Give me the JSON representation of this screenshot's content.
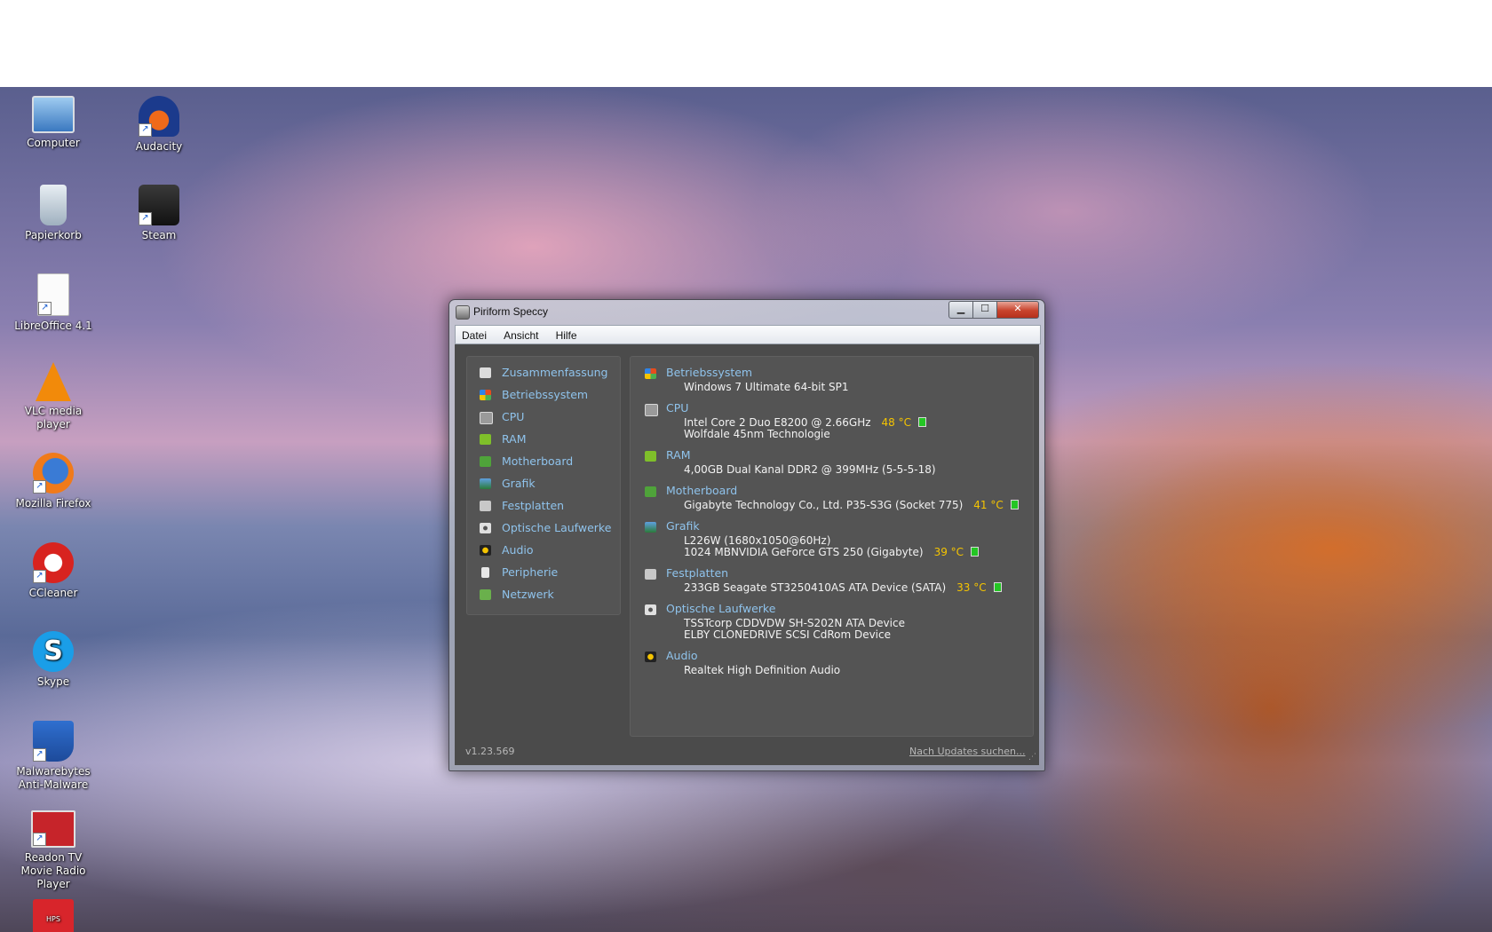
{
  "desktop": {
    "icons": [
      {
        "label": "Computer",
        "icon": "computer-icon"
      },
      {
        "label": "Audacity",
        "icon": "audacity-icon"
      },
      {
        "label": "Papierkorb",
        "icon": "recycle-bin-icon"
      },
      {
        "label": "Steam",
        "icon": "steam-icon"
      },
      {
        "label": "LibreOffice 4.1",
        "icon": "libreoffice-icon"
      },
      {
        "label": "VLC media player",
        "icon": "vlc-icon"
      },
      {
        "label": "Mozilla Firefox",
        "icon": "firefox-icon"
      },
      {
        "label": "CCleaner",
        "icon": "ccleaner-icon"
      },
      {
        "label": "Skype",
        "icon": "skype-icon",
        "glyph": "S"
      },
      {
        "label": "Malwarebytes Anti-Malware",
        "icon": "malwarebytes-icon"
      },
      {
        "label": "Readon TV Movie Radio Player",
        "icon": "readon-tv-icon"
      },
      {
        "label": "",
        "icon": "pdf-icon",
        "glyph": "HPS"
      }
    ]
  },
  "window": {
    "title": "Piriform Speccy",
    "buttons": {
      "minimize": "▁",
      "maximize": "☐",
      "close": "✕"
    },
    "menu": [
      "Datei",
      "Ansicht",
      "Hilfe"
    ],
    "sidebar": [
      {
        "label": "Zusammenfassung",
        "icon": "summary-icon"
      },
      {
        "label": "Betriebssystem",
        "icon": "windows-icon"
      },
      {
        "label": "CPU",
        "icon": "cpu-icon"
      },
      {
        "label": "RAM",
        "icon": "ram-icon"
      },
      {
        "label": "Motherboard",
        "icon": "motherboard-icon"
      },
      {
        "label": "Grafik",
        "icon": "monitor-icon"
      },
      {
        "label": "Festplatten",
        "icon": "hard-disk-icon"
      },
      {
        "label": "Optische Laufwerke",
        "icon": "optical-drive-icon"
      },
      {
        "label": "Audio",
        "icon": "speaker-icon"
      },
      {
        "label": "Peripherie",
        "icon": "mouse-icon"
      },
      {
        "label": "Netzwerk",
        "icon": "network-icon"
      }
    ],
    "summary": {
      "os": {
        "title": "Betriebssystem",
        "lines": [
          "Windows 7 Ultimate 64-bit SP1"
        ]
      },
      "cpu": {
        "title": "CPU",
        "lines": [
          "Intel Core 2 Duo E8200 @ 2.66GHz",
          "Wolfdale 45nm Technologie"
        ],
        "temp": "48 °C"
      },
      "ram": {
        "title": "RAM",
        "lines": [
          "4,00GB Dual Kanal DDR2 @ 399MHz (5-5-5-18)"
        ]
      },
      "motherboard": {
        "title": "Motherboard",
        "lines": [
          "Gigabyte Technology Co., Ltd. P35-S3G (Socket 775)"
        ],
        "temp": "41 °C"
      },
      "graphics": {
        "title": "Grafik",
        "lines": [
          "L226W (1680x1050@60Hz)",
          "1024 MBNVIDIA GeForce GTS 250 (Gigabyte)"
        ],
        "temp": "39 °C"
      },
      "storage": {
        "title": "Festplatten",
        "lines": [
          "233GB Seagate ST3250410AS ATA Device (SATA)"
        ],
        "temp": "33 °C"
      },
      "optical": {
        "title": "Optische Laufwerke",
        "lines": [
          "TSSTcorp CDDVDW SH-S202N ATA Device",
          "ELBY CLONEDRIVE SCSI CdRom Device"
        ]
      },
      "audio": {
        "title": "Audio",
        "lines": [
          "Realtek High Definition Audio"
        ]
      }
    },
    "footer": {
      "version": "v1.23.569",
      "update_link": "Nach Updates suchen..."
    }
  }
}
